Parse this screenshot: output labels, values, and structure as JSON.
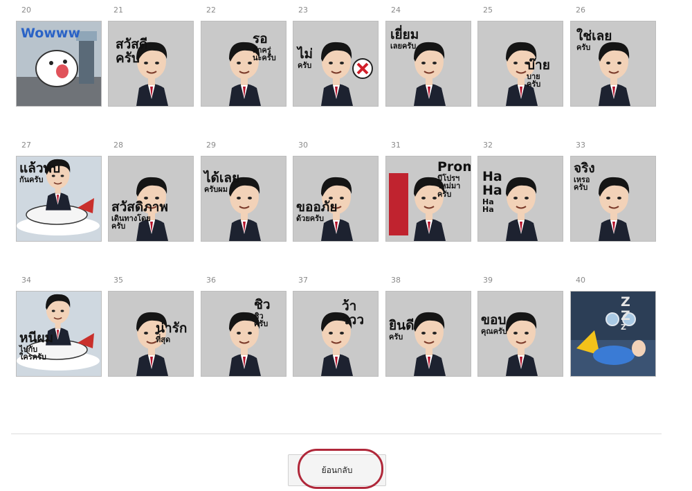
{
  "stickers": [
    {
      "num": "20",
      "lines": [
        "Wowww"
      ],
      "sub": [],
      "scene": "cloud"
    },
    {
      "num": "21",
      "lines": [
        "สวัสดี",
        "ครับ"
      ],
      "sub": [],
      "scene": "man"
    },
    {
      "num": "22",
      "lines": [
        "รอ"
      ],
      "sub": [
        "สักครู่",
        "นะครับ"
      ],
      "scene": "man"
    },
    {
      "num": "23",
      "lines": [
        "ไม่"
      ],
      "sub": [
        "ครับ"
      ],
      "scene": "man-x"
    },
    {
      "num": "24",
      "lines": [
        "เยี่ยม"
      ],
      "sub": [
        "เลยครับ"
      ],
      "scene": "man"
    },
    {
      "num": "25",
      "lines": [
        "บ๊าย"
      ],
      "sub": [
        "บาย",
        "ครับ"
      ],
      "scene": "man"
    },
    {
      "num": "26",
      "lines": [
        "ใช่เลย"
      ],
      "sub": [
        "ครับ"
      ],
      "scene": "man"
    },
    {
      "num": "27",
      "lines": [
        "แล้วพบ"
      ],
      "sub": [
        "กันครับ"
      ],
      "scene": "plane"
    },
    {
      "num": "28",
      "lines": [
        "สวัสดิภาพ"
      ],
      "sub": [
        "เดินทางโดย",
        "ครับ"
      ],
      "scene": "man"
    },
    {
      "num": "29",
      "lines": [
        "ได้เลย"
      ],
      "sub": [
        "ครับผม"
      ],
      "scene": "man"
    },
    {
      "num": "30",
      "lines": [
        "ขออภัย"
      ],
      "sub": [
        "ด้วยครับ"
      ],
      "scene": "man"
    },
    {
      "num": "31",
      "lines": [
        "Promotion"
      ],
      "sub": [
        "มีโปรฯ",
        "ใหม่มา",
        "ครับ"
      ],
      "scene": "promo"
    },
    {
      "num": "32",
      "lines": [
        "Ha",
        "Ha"
      ],
      "sub": [
        "Ha",
        "Ha"
      ],
      "scene": "man"
    },
    {
      "num": "33",
      "lines": [
        "จริง"
      ],
      "sub": [
        "เหรอ",
        "ครับ"
      ],
      "scene": "man"
    },
    {
      "num": "34",
      "lines": [
        "หนีผม"
      ],
      "sub": [
        "ไปกับ",
        "ใครครับ"
      ],
      "scene": "plane"
    },
    {
      "num": "35",
      "lines": [
        "น่ารัก"
      ],
      "sub": [
        "ที่สุด"
      ],
      "scene": "man"
    },
    {
      "num": "36",
      "lines": [
        "ชิว"
      ],
      "sub": [
        "ชิว",
        "ครับ"
      ],
      "scene": "man"
    },
    {
      "num": "37",
      "lines": [
        "ว้าววว"
      ],
      "sub": [],
      "scene": "man"
    },
    {
      "num": "38",
      "lines": [
        "ยินดี"
      ],
      "sub": [
        "ครับ"
      ],
      "scene": "man"
    },
    {
      "num": "39",
      "lines": [
        "ขอบ"
      ],
      "sub": [
        "คุณครับ"
      ],
      "scene": "man"
    },
    {
      "num": "40",
      "lines": [
        "Z",
        "Z"
      ],
      "sub": [
        "Z"
      ],
      "scene": "sleep"
    }
  ],
  "footer": {
    "back_label": "ย้อนกลับ"
  },
  "colors": {
    "tile_bg": "#c9c9c9",
    "suit": "#1d2230",
    "skin": "#f2d2b8",
    "hair": "#151515",
    "tie": "#b3122a",
    "accent_ring": "#b0283a"
  }
}
